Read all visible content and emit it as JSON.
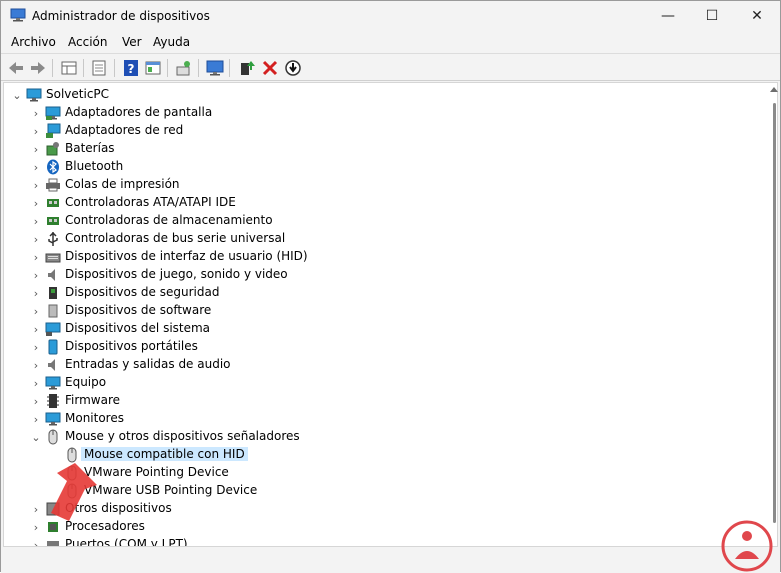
{
  "window": {
    "title": "Administrador de dispositivos",
    "controls": {
      "minimize": "—",
      "maximize": "☐",
      "close": "✕"
    }
  },
  "menu": [
    "Archivo",
    "Acción",
    "Ver",
    "Ayuda"
  ],
  "toolbar": [
    "back-arrow-icon",
    "forward-arrow-icon",
    "properties-grid-icon",
    "document-icon",
    "help-icon",
    "view-icon",
    "scan-hardware-icon",
    "monitor-icon",
    "add-driver-icon",
    "remove-device-icon",
    "update-driver-icon"
  ],
  "tree": {
    "root": "SolveticPC",
    "categories": [
      {
        "label": "Adaptadores de pantalla",
        "icon": "display-adapter-icon"
      },
      {
        "label": "Adaptadores de red",
        "icon": "network-adapter-icon"
      },
      {
        "label": "Baterías",
        "icon": "battery-icon"
      },
      {
        "label": "Bluetooth",
        "icon": "bluetooth-icon"
      },
      {
        "label": "Colas de impresión",
        "icon": "printer-icon"
      },
      {
        "label": "Controladoras ATA/ATAPI IDE",
        "icon": "ide-controller-icon"
      },
      {
        "label": "Controladoras de almacenamiento",
        "icon": "storage-controller-icon"
      },
      {
        "label": "Controladoras de bus serie universal",
        "icon": "usb-icon"
      },
      {
        "label": "Dispositivos de interfaz de usuario (HID)",
        "icon": "hid-icon"
      },
      {
        "label": "Dispositivos de juego, sonido y video",
        "icon": "speaker-icon"
      },
      {
        "label": "Dispositivos de seguridad",
        "icon": "security-device-icon"
      },
      {
        "label": "Dispositivos de software",
        "icon": "software-device-icon"
      },
      {
        "label": "Dispositivos del sistema",
        "icon": "system-device-icon"
      },
      {
        "label": "Dispositivos portátiles",
        "icon": "portable-device-icon"
      },
      {
        "label": "Entradas y salidas de audio",
        "icon": "audio-io-icon"
      },
      {
        "label": "Equipo",
        "icon": "computer-icon"
      },
      {
        "label": "Firmware",
        "icon": "firmware-icon"
      },
      {
        "label": "Monitores",
        "icon": "monitor-icon"
      },
      {
        "label": "Mouse y otros dispositivos señaladores",
        "icon": "mouse-icon",
        "expanded": true
      }
    ],
    "mouse_children": [
      {
        "label": "Mouse compatible con HID",
        "selected": true
      },
      {
        "label": "VMware Pointing Device"
      },
      {
        "label": "VMware USB Pointing Device"
      }
    ],
    "after": [
      {
        "label": "Otros dispositivos",
        "icon": "other-devices-icon"
      },
      {
        "label": "Procesadores",
        "icon": "processor-icon"
      },
      {
        "label": "Puertos (COM y LPT)",
        "icon": "port-icon"
      }
    ]
  },
  "colors": {
    "selection": "#cce8ff",
    "red_arrow": "#e53935",
    "logo": "#e0474c"
  }
}
